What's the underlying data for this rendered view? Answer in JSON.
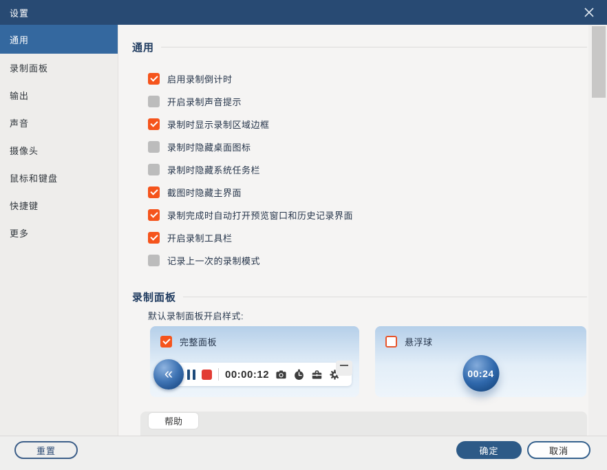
{
  "window": {
    "title": "设置"
  },
  "colors": {
    "titlebar_blue": "#284a73",
    "selected_blue": "#34689f",
    "accent_orange": "#f5541c",
    "primary_button_blue": "#2d5a87",
    "panel_gradient_top": "#b5cfe9"
  },
  "icons": {
    "close_icon": "✕",
    "collapse_icon": "«",
    "minimize_icon": "–",
    "pause_icon": "pause-bars",
    "stop_icon": "red-square",
    "camera_icon": "camera",
    "timer_icon": "stopwatch",
    "toolbox_icon": "toolbox",
    "gear_icon": "gear"
  },
  "sidebar": {
    "items": [
      {
        "label": "通用",
        "selected": true
      },
      {
        "label": "录制面板",
        "selected": false
      },
      {
        "label": "输出",
        "selected": false
      },
      {
        "label": "声音",
        "selected": false
      },
      {
        "label": "摄像头",
        "selected": false
      },
      {
        "label": "鼠标和键盘",
        "selected": false
      },
      {
        "label": "快捷键",
        "selected": false
      },
      {
        "label": "更多",
        "selected": false
      }
    ]
  },
  "general_section": {
    "title": "通用",
    "checkboxes": [
      {
        "label": "启用录制倒计时",
        "checked": true
      },
      {
        "label": "开启录制声音提示",
        "checked": false
      },
      {
        "label": "录制时显示录制区域边框",
        "checked": true
      },
      {
        "label": "录制时隐藏桌面图标",
        "checked": false
      },
      {
        "label": "录制时隐藏系统任务栏",
        "checked": false
      },
      {
        "label": "截图时隐藏主界面",
        "checked": true
      },
      {
        "label": "录制完成时自动打开预览窗口和历史记录界面",
        "checked": true
      },
      {
        "label": "开启录制工具栏",
        "checked": true
      },
      {
        "label": "记录上一次的录制模式",
        "checked": false
      }
    ]
  },
  "panel_section": {
    "title": "录制面板",
    "style_label": "默认录制面板开启样式:",
    "full_panel": {
      "label": "完整面板",
      "checked": true,
      "timer": "00:00:12"
    },
    "float_ball": {
      "label": "悬浮球",
      "checked": false,
      "timer": "00:24"
    }
  },
  "help": {
    "label": "帮助"
  },
  "footer": {
    "reset_label": "重置",
    "ok_label": "确定",
    "cancel_label": "取消"
  }
}
